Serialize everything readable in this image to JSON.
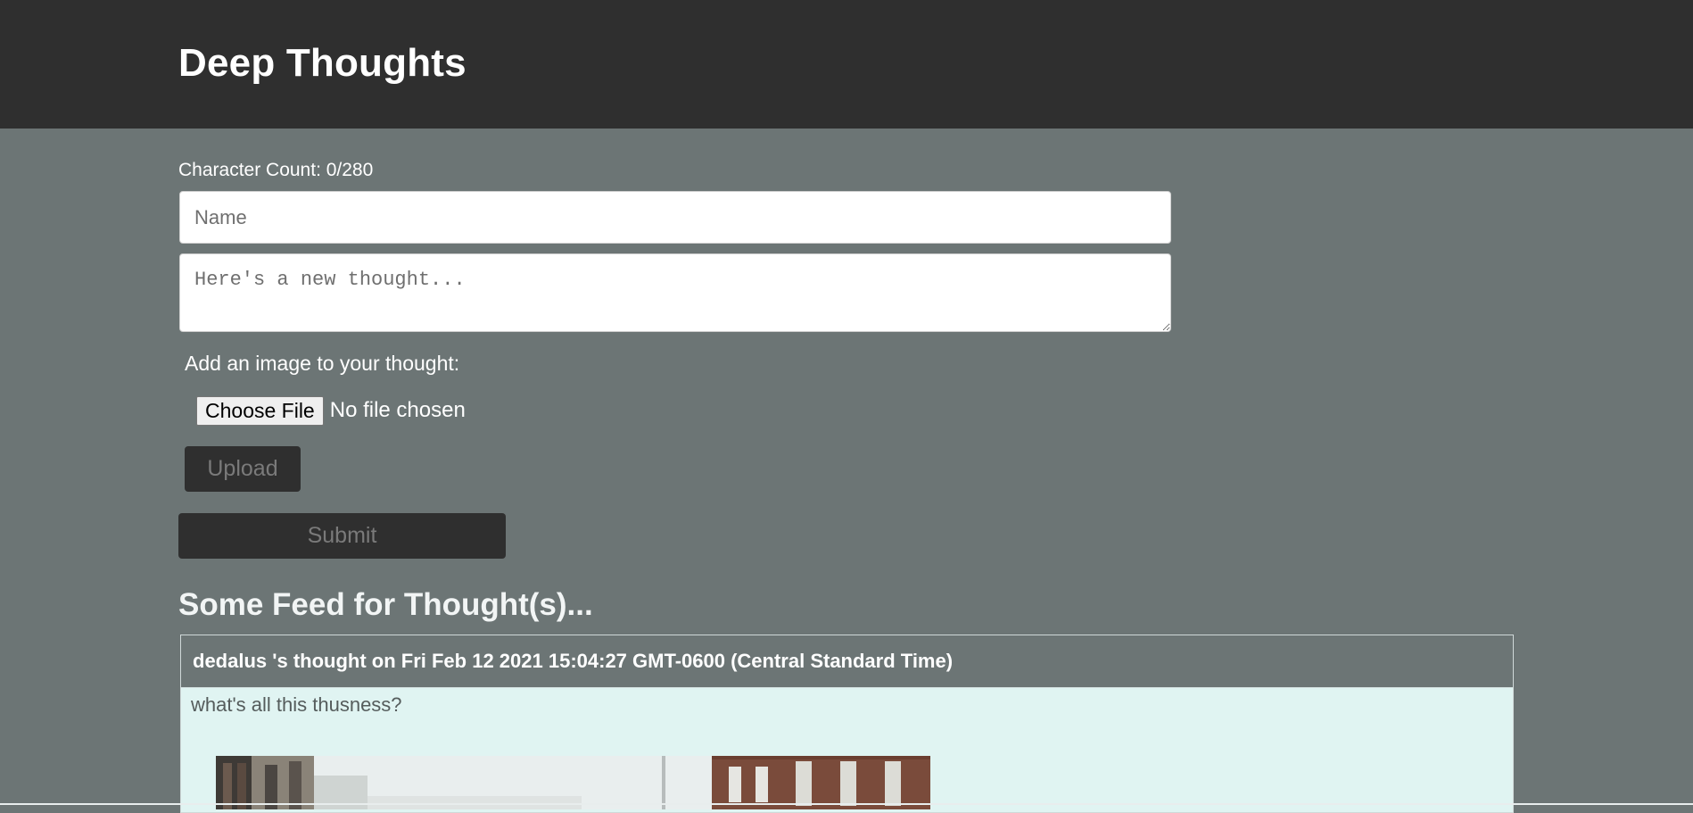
{
  "header": {
    "title": "Deep Thoughts"
  },
  "form": {
    "character_count": "Character Count: 0/280",
    "name_placeholder": "Name",
    "thought_placeholder": "Here's a new thought...",
    "add_image_label": "Add an image to your thought:",
    "choose_file_label": "Choose File",
    "no_file_label": "No file chosen",
    "upload_label": "Upload",
    "submit_label": "Submit"
  },
  "feed": {
    "title": "Some Feed for Thought(s)...",
    "items": [
      {
        "header": "dedalus 's thought on Fri Feb 12 2021 15:04:27 GMT-0600 (Central Standard Time)",
        "text": "what's all this thusness?"
      }
    ]
  },
  "colors": {
    "header_bg": "#2f2f2f",
    "page_bg": "#6c7575",
    "card_bg": "#e0f4f2",
    "button_bg": "#2f2f2f"
  }
}
